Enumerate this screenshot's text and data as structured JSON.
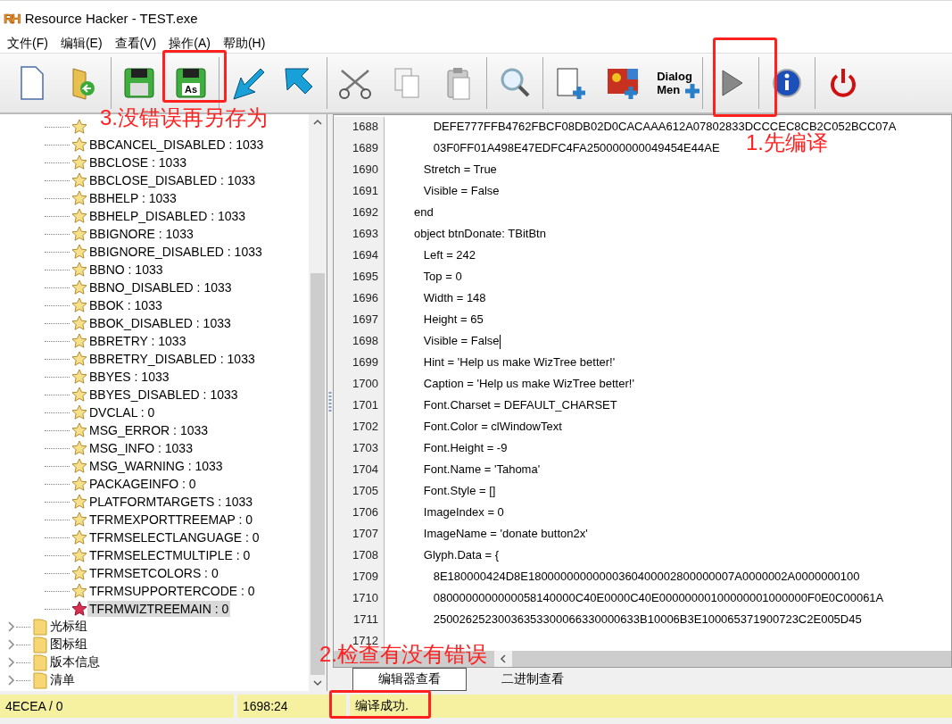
{
  "window": {
    "badge": "RH",
    "title": "Resource Hacker - TEST.exe"
  },
  "menu": [
    "文件(F)",
    "编辑(E)",
    "查看(V)",
    "操作(A)",
    "帮助(H)"
  ],
  "toolbar": [
    {
      "kind": "new"
    },
    {
      "kind": "open"
    },
    {
      "kind": "sep"
    },
    {
      "kind": "save"
    },
    {
      "kind": "save_as",
      "label": "As"
    },
    {
      "kind": "sep"
    },
    {
      "kind": "import"
    },
    {
      "kind": "export"
    },
    {
      "kind": "sep"
    },
    {
      "kind": "cut"
    },
    {
      "kind": "copy"
    },
    {
      "kind": "paste"
    },
    {
      "kind": "sep"
    },
    {
      "kind": "find"
    },
    {
      "kind": "sep"
    },
    {
      "kind": "add_blank"
    },
    {
      "kind": "add_image"
    },
    {
      "kind": "add_dialog",
      "lines": [
        "Dialog",
        "Men"
      ]
    },
    {
      "kind": "sep"
    },
    {
      "kind": "compile"
    },
    {
      "kind": "sep"
    },
    {
      "kind": "info"
    },
    {
      "kind": "sep"
    },
    {
      "kind": "exit"
    }
  ],
  "tree": [
    {
      "kind": "resource",
      "selected": false
    },
    {
      "kind": "resource",
      "label": "BBCANCEL_DISABLED : 1033",
      "selected": false
    },
    {
      "kind": "resource",
      "label": "BBCLOSE : 1033",
      "selected": false
    },
    {
      "kind": "resource",
      "label": "BBCLOSE_DISABLED : 1033",
      "selected": false
    },
    {
      "kind": "resource",
      "label": "BBHELP : 1033",
      "selected": false
    },
    {
      "kind": "resource",
      "label": "BBHELP_DISABLED : 1033",
      "selected": false
    },
    {
      "kind": "resource",
      "label": "BBIGNORE : 1033",
      "selected": false
    },
    {
      "kind": "resource",
      "label": "BBIGNORE_DISABLED : 1033",
      "selected": false
    },
    {
      "kind": "resource",
      "label": "BBNO : 1033",
      "selected": false
    },
    {
      "kind": "resource",
      "label": "BBNO_DISABLED : 1033",
      "selected": false
    },
    {
      "kind": "resource",
      "label": "BBOK : 1033",
      "selected": false
    },
    {
      "kind": "resource",
      "label": "BBOK_DISABLED : 1033",
      "selected": false
    },
    {
      "kind": "resource",
      "label": "BBRETRY : 1033",
      "selected": false
    },
    {
      "kind": "resource",
      "label": "BBRETRY_DISABLED : 1033",
      "selected": false
    },
    {
      "kind": "resource",
      "label": "BBYES : 1033",
      "selected": false
    },
    {
      "kind": "resource",
      "label": "BBYES_DISABLED : 1033",
      "selected": false
    },
    {
      "kind": "resource",
      "label": "DVCLAL : 0",
      "selected": false
    },
    {
      "kind": "resource",
      "label": "MSG_ERROR : 1033",
      "selected": false
    },
    {
      "kind": "resource",
      "label": "MSG_INFO : 1033",
      "selected": false
    },
    {
      "kind": "resource",
      "label": "MSG_WARNING : 1033",
      "selected": false
    },
    {
      "kind": "resource",
      "label": "PACKAGEINFO : 0",
      "selected": false
    },
    {
      "kind": "resource",
      "label": "PLATFORMTARGETS : 1033",
      "selected": false
    },
    {
      "kind": "resource",
      "label": "TFRMEXPORTTREEMAP : 0",
      "selected": false
    },
    {
      "kind": "resource",
      "label": "TFRMSELECTLANGUAGE : 0",
      "selected": false
    },
    {
      "kind": "resource",
      "label": "TFRMSELECTMULTIPLE : 0",
      "selected": false
    },
    {
      "kind": "resource",
      "label": "TFRMSETCOLORS : 0",
      "selected": false
    },
    {
      "kind": "resource",
      "label": "TFRMSUPPORTERCODE : 0",
      "selected": false
    },
    {
      "kind": "resource",
      "label": "TFRMWIZTREEMAIN : 0",
      "selected": true
    },
    {
      "kind": "folder",
      "label": "光标组",
      "expanded": false
    },
    {
      "kind": "folder",
      "label": "图标组",
      "expanded": false
    },
    {
      "kind": "folder",
      "label": "版本信息",
      "expanded": false
    },
    {
      "kind": "folder",
      "label": "清单",
      "expanded": false
    }
  ],
  "editor": {
    "lines": [
      {
        "number": "1688",
        "code": "      DEFE777FFB4762FBCF08DB02D0CACAAA612A07802833DCCCEC8CB2C052BCC07A"
      },
      {
        "number": "1689",
        "code": "      03F0FF01A498E47EDFC4FA250000000049454E44AE"
      },
      {
        "number": "1690",
        "code": "   Stretch = True"
      },
      {
        "number": "1691",
        "code": "   Visible = False"
      },
      {
        "number": "1692",
        "code": "end"
      },
      {
        "number": "1693",
        "code": "object btnDonate: TBitBtn"
      },
      {
        "number": "1694",
        "code": "   Left = 242"
      },
      {
        "number": "1695",
        "code": "   Top = 0"
      },
      {
        "number": "1696",
        "code": "   Width = 148"
      },
      {
        "number": "1697",
        "code": "   Height = 65"
      },
      {
        "number": "1698",
        "code": "   Visible = False",
        "cursor": true
      },
      {
        "number": "1699",
        "code": "   Hint = 'Help us make WizTree better!'"
      },
      {
        "number": "1700",
        "code": "   Caption = 'Help us make WizTree better!'"
      },
      {
        "number": "1701",
        "code": "   Font.Charset = DEFAULT_CHARSET"
      },
      {
        "number": "1702",
        "code": "   Font.Color = clWindowText"
      },
      {
        "number": "1703",
        "code": "   Font.Height = -9"
      },
      {
        "number": "1704",
        "code": "   Font.Name = 'Tahoma'"
      },
      {
        "number": "1705",
        "code": "   Font.Style = []"
      },
      {
        "number": "1706",
        "code": "   ImageIndex = 0"
      },
      {
        "number": "1707",
        "code": "   ImageName = 'donate button2x'"
      },
      {
        "number": "1708",
        "code": "   Glyph.Data = {"
      },
      {
        "number": "1709",
        "code": "      8E180000424D8E18000000000000360400002800000007A0000002A0000000100"
      },
      {
        "number": "1710",
        "code": "      0800000000000058140000C40E0000C40E00000000100000001000000F0E0C00061A"
      },
      {
        "number": "1711",
        "code": "      25002625230036353300066330000633B10006B3E100065371900723C2E005D45"
      },
      {
        "number": "1712"
      }
    ]
  },
  "view_tabs": [
    {
      "label": "编辑器查看",
      "selected": true
    },
    {
      "label": "二进制查看",
      "selected": false
    }
  ],
  "status_bar": [
    "4ECEA / 0",
    "1698:24",
    "编译成功."
  ],
  "annotations": [
    {
      "kind": "box"
    },
    {
      "kind": "text",
      "text": "3.没错误再另存为"
    },
    {
      "kind": "box"
    },
    {
      "kind": "text",
      "text": "1.先编译"
    },
    {
      "kind": "text",
      "text": "2.检查有没有错误"
    },
    {
      "kind": "box"
    }
  ]
}
